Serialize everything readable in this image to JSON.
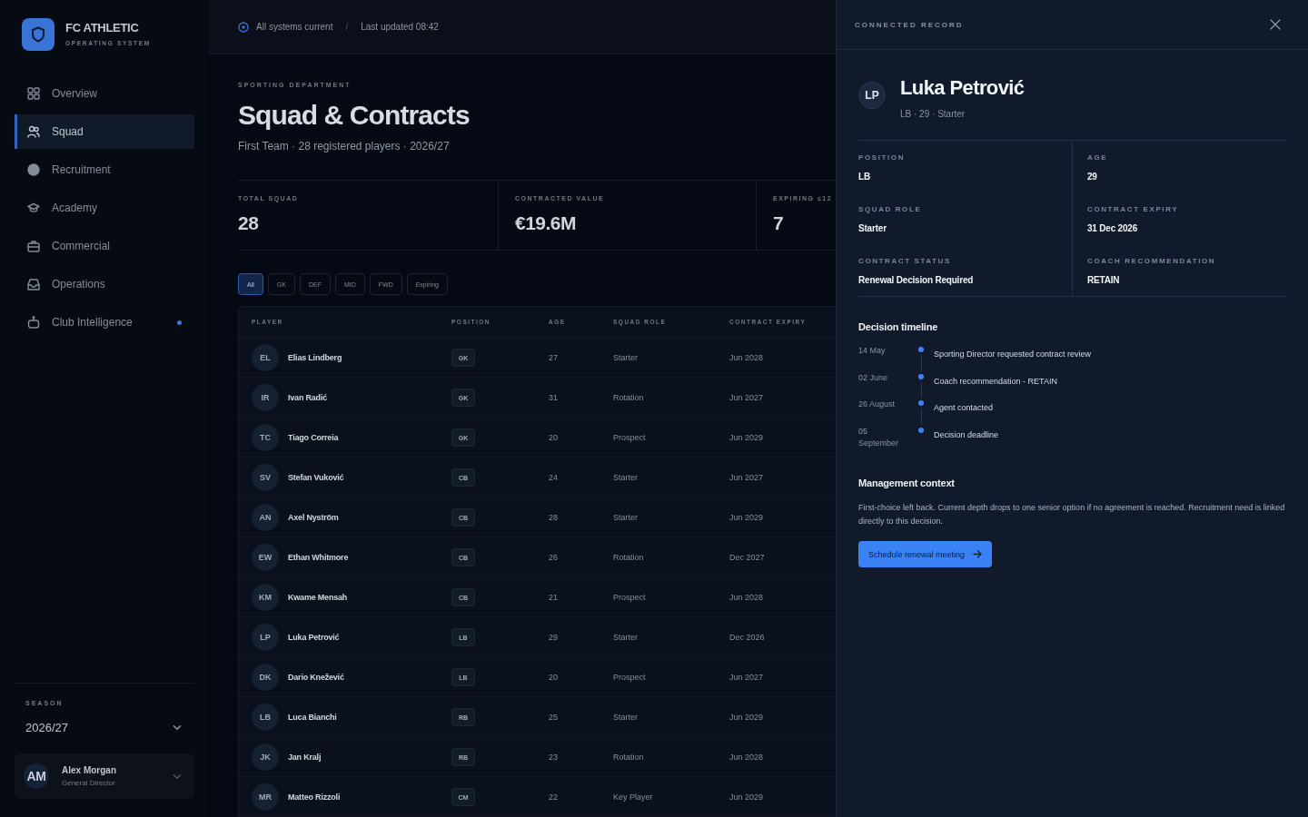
{
  "sidebar": {
    "brand": {
      "name": "FC ATHLETIC",
      "tagline": "OPERATING SYSTEM"
    },
    "nav": [
      {
        "label": "Overview",
        "selected": false,
        "alert": false
      },
      {
        "label": "Squad",
        "selected": true,
        "alert": false
      },
      {
        "label": "Recruitment",
        "selected": false,
        "alert": false
      },
      {
        "label": "Academy",
        "selected": false,
        "alert": false
      },
      {
        "label": "Commercial",
        "selected": false,
        "alert": false
      },
      {
        "label": "Operations",
        "selected": false,
        "alert": false
      },
      {
        "label": "Club Intelligence",
        "selected": false,
        "alert": true
      }
    ],
    "season": {
      "label": "SEASON",
      "value": "2026/27"
    },
    "user": {
      "initials": "AM",
      "name": "Alex Morgan",
      "role": "General Director"
    }
  },
  "topbar": {
    "status": "All systems current",
    "separator": "/",
    "updated": "Last updated 08:42"
  },
  "page": {
    "eyebrow": "SPORTING DEPARTMENT",
    "title": "Squad & Contracts",
    "subtitle": "First Team · 28 registered players · 2026/27"
  },
  "kpis": [
    {
      "label": "TOTAL SQUAD",
      "value": "28"
    },
    {
      "label": "CONTRACTED VALUE",
      "value": "€19.6M"
    },
    {
      "label": "EXPIRING ≤12",
      "value": "7"
    }
  ],
  "filters": [
    {
      "label": "All",
      "selected": true
    },
    {
      "label": "GK",
      "selected": false
    },
    {
      "label": "DEF",
      "selected": false
    },
    {
      "label": "MID",
      "selected": false
    },
    {
      "label": "FWD",
      "selected": false
    },
    {
      "label": "Expiring",
      "selected": false
    }
  ],
  "table": {
    "columns": [
      "PLAYER",
      "POSITION",
      "AGE",
      "SQUAD ROLE",
      "CONTRACT EXPIRY"
    ],
    "rows": [
      {
        "initials": "EL",
        "name": "Elias Lindberg",
        "position": "GK",
        "age": "27",
        "role": "Starter",
        "expiry": "Jun 2028"
      },
      {
        "initials": "IR",
        "name": "Ivan Radić",
        "position": "GK",
        "age": "31",
        "role": "Rotation",
        "expiry": "Jun 2027"
      },
      {
        "initials": "TC",
        "name": "Tiago Correia",
        "position": "GK",
        "age": "20",
        "role": "Prospect",
        "expiry": "Jun 2029"
      },
      {
        "initials": "SV",
        "name": "Stefan Vuković",
        "position": "CB",
        "age": "24",
        "role": "Starter",
        "expiry": "Jun 2027"
      },
      {
        "initials": "AN",
        "name": "Axel Nyström",
        "position": "CB",
        "age": "28",
        "role": "Starter",
        "expiry": "Jun 2029"
      },
      {
        "initials": "EW",
        "name": "Ethan Whitmore",
        "position": "CB",
        "age": "26",
        "role": "Rotation",
        "expiry": "Dec 2027"
      },
      {
        "initials": "KM",
        "name": "Kwame Mensah",
        "position": "CB",
        "age": "21",
        "role": "Prospect",
        "expiry": "Jun 2028"
      },
      {
        "initials": "LP",
        "name": "Luka Petrović",
        "position": "LB",
        "age": "29",
        "role": "Starter",
        "expiry": "Dec 2026"
      },
      {
        "initials": "DK",
        "name": "Dario Knežević",
        "position": "LB",
        "age": "20",
        "role": "Prospect",
        "expiry": "Jun 2027"
      },
      {
        "initials": "LB",
        "name": "Luca Bianchi",
        "position": "RB",
        "age": "25",
        "role": "Starter",
        "expiry": "Jun 2029"
      },
      {
        "initials": "JK",
        "name": "Jan Kralj",
        "position": "RB",
        "age": "23",
        "role": "Rotation",
        "expiry": "Jun 2028"
      },
      {
        "initials": "MR",
        "name": "Matteo Rizzoli",
        "position": "CM",
        "age": "22",
        "role": "Key Player",
        "expiry": "Jun 2029"
      }
    ]
  },
  "drawer": {
    "eyebrow": "CONNECTED RECORD",
    "initials": "LP",
    "name": "Luka Petrović",
    "meta": "LB · 29 · Starter",
    "fields": [
      {
        "label": "POSITION",
        "value": "LB"
      },
      {
        "label": "AGE",
        "value": "29"
      },
      {
        "label": "SQUAD ROLE",
        "value": "Starter"
      },
      {
        "label": "CONTRACT EXPIRY",
        "value": "31 Dec 2026"
      },
      {
        "label": "CONTRACT STATUS",
        "value": "Renewal Decision Required"
      },
      {
        "label": "COACH RECOMMENDATION",
        "value": "RETAIN"
      }
    ],
    "timeline_title": "Decision timeline",
    "timeline": [
      {
        "date": "14 May",
        "event": "Sporting Director requested contract review"
      },
      {
        "date": "02 June",
        "event": "Coach recommendation - RETAIN"
      },
      {
        "date": "26 August",
        "event": "Agent contacted"
      },
      {
        "date": "05 September",
        "event": "Decision deadline"
      }
    ],
    "context_title": "Management context",
    "context_text": "First-choice left back. Current depth drops to one senior option if no agreement is reached. Recruitment need is linked directly to this decision.",
    "action": "Schedule renewal meeting"
  }
}
